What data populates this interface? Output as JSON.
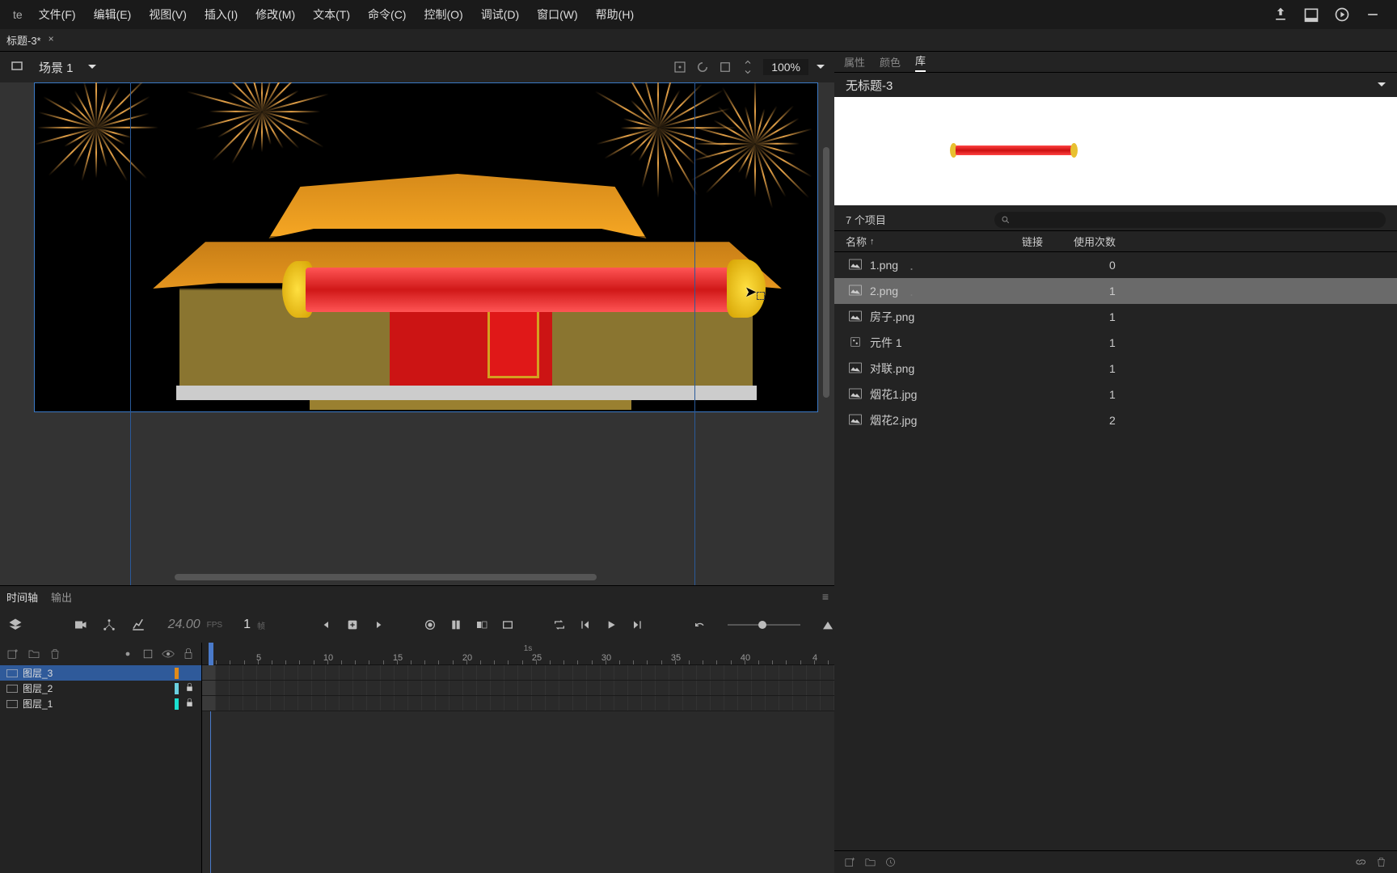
{
  "app_suffix": "te",
  "menu": [
    "文件(F)",
    "编辑(E)",
    "视图(V)",
    "插入(I)",
    "修改(M)",
    "文本(T)",
    "命令(C)",
    "控制(O)",
    "调试(D)",
    "窗口(W)",
    "帮助(H)"
  ],
  "tab": {
    "title": "标题-3*",
    "close": "×"
  },
  "stage": {
    "scene": "场景 1",
    "zoom": "100%"
  },
  "timeline": {
    "tabs": [
      "时间轴",
      "输出"
    ],
    "fps": "24.00",
    "fps_label": "FPS",
    "frame": "1",
    "frame_label": "帧",
    "ruler_1s": "1s",
    "ruler_marks": [
      "5",
      "10",
      "15",
      "20",
      "25",
      "30",
      "35",
      "40",
      "4"
    ],
    "layers": [
      {
        "name": "图层_3",
        "color": "#e08a1a",
        "locked": false,
        "selected": true
      },
      {
        "name": "图层_2",
        "color": "#6ad0e0",
        "locked": true,
        "selected": false
      },
      {
        "name": "图层_1",
        "color": "#1ae0d0",
        "locked": true,
        "selected": false
      }
    ]
  },
  "library": {
    "tabs": [
      "属性",
      "颜色",
      "库"
    ],
    "doc_name": "无标题-3",
    "item_count": "7 个项目",
    "search_placeholder": "",
    "headers": {
      "name": "名称",
      "link": "链接",
      "use": "使用次数"
    },
    "sort_arrow": "↑",
    "items": [
      {
        "icon": "image",
        "name": "1.png",
        "dot": true,
        "use": "0",
        "selected": false
      },
      {
        "icon": "image",
        "name": "2.png",
        "dot": true,
        "use": "1",
        "selected": true
      },
      {
        "icon": "image",
        "name": "房子.png",
        "use": "1",
        "selected": false
      },
      {
        "icon": "clip",
        "name": "元件 1",
        "use": "1",
        "selected": false
      },
      {
        "icon": "image",
        "name": "对联.png",
        "use": "1",
        "selected": false
      },
      {
        "icon": "image",
        "name": "烟花1.jpg",
        "use": "1",
        "selected": false
      },
      {
        "icon": "image",
        "name": "烟花2.jpg",
        "use": "2",
        "selected": false
      }
    ]
  }
}
